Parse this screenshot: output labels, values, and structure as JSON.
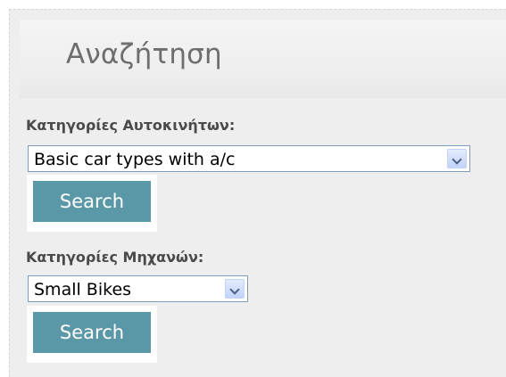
{
  "search_panel": {
    "title": "Αναζήτηση",
    "car_section": {
      "label": "Κατηγορίες Αυτοκινήτων:",
      "selected_value": "Basic car types with a/c",
      "button_label": "Search"
    },
    "bike_section": {
      "label": "Κατηγορίες Μηχανών:",
      "selected_value": "Small Bikes",
      "button_label": "Search"
    }
  },
  "colors": {
    "panel_background": "#eeeeee",
    "button_background": "#5b98a7",
    "button_text": "#ffffff",
    "title_text": "#6e6e6e",
    "label_text": "#4a4a4a"
  }
}
